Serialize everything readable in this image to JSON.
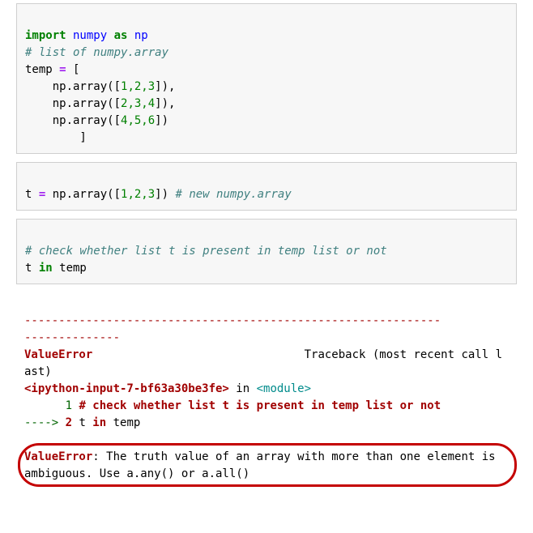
{
  "cell1": {
    "l1_kw": "import",
    "l1_name": " numpy ",
    "l1_as": "as",
    "l1_alias": " np",
    "l2_comment": "# list of numpy.array",
    "l3_a": "temp ",
    "l3_eq": "= ",
    "l3_b": "[",
    "l4_a": "    np.array([",
    "l4_nums": "1,2,3",
    "l4_b": "]),",
    "l5_a": "    np.array([",
    "l5_nums": "2,3,4",
    "l5_b": "]),",
    "l6_a": "    np.array([",
    "l6_nums": "4,5,6",
    "l6_b": "])",
    "l7": "        ]"
  },
  "cell2": {
    "a": "t ",
    "eq": "= ",
    "b": "np.array([",
    "nums": "1,2,3",
    "c": "]) ",
    "comment": "# new numpy.array"
  },
  "cell3": {
    "comment": "# check whether list t is present in temp list or not",
    "l2a": "t ",
    "l2kw": "in",
    "l2b": " temp"
  },
  "tb": {
    "sepL1": "-------------------------------------------------------------",
    "sepL2": "--------------",
    "err_name": "ValueError",
    "trace_txt": "                               Traceback (most recent call last)",
    "loc": "<ipython-input-7-bf63a30be3fe>",
    "in_txt": " in ",
    "module": "<module>",
    "line1_num": "      1 ",
    "line1_txt": "# check whether list t is present in temp list or not",
    "arrow": "----> ",
    "line2_num": "2 ",
    "line2_a": "t ",
    "line2_in": "in",
    "line2_b": " temp",
    "final_name": "ValueError",
    "final_msg": ": The truth value of an array with more than one element is ambiguous. Use a.any() or a.all()"
  }
}
